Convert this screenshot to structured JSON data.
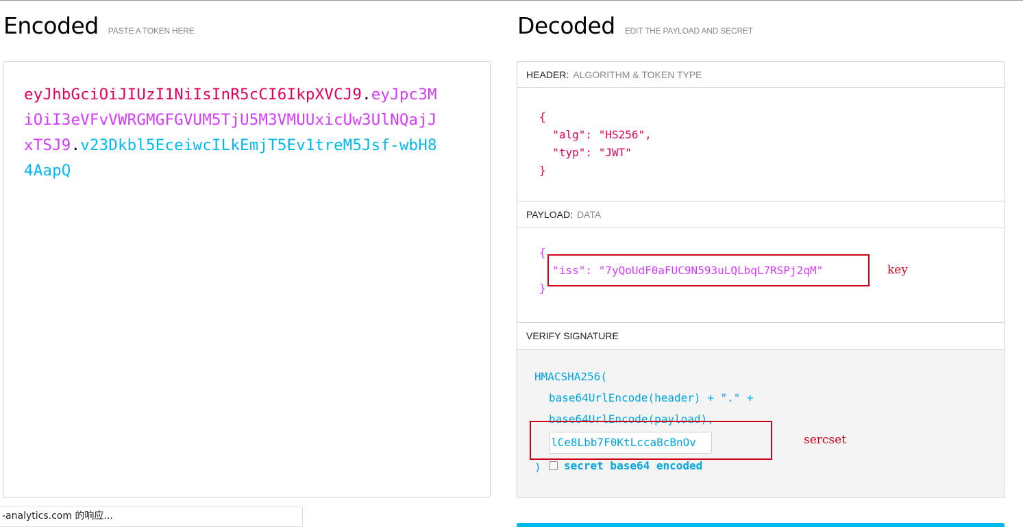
{
  "encoded": {
    "title": "Encoded",
    "subtitle": "PASTE A TOKEN HERE",
    "token_header": "eyJhbGciOiJIUzI1NiIsInR5cCI6IkpXVCJ9",
    "token_payload": "eyJpc3MiOiI3eVFvVWRGMGFGVUM5TjU5M3VMUUxicUw3UlNQajJxTSJ9",
    "token_signature": "v23Dkbl5EceiwcILkEmjT5Ev1treM5Jsf-wbH84AapQ",
    "dot": "."
  },
  "decoded": {
    "title": "Decoded",
    "subtitle": "EDIT THE PAYLOAD AND SECRET",
    "header_section": {
      "label": "HEADER:",
      "sublabel": "ALGORITHM & TOKEN TYPE",
      "json": "{\n  \"alg\": \"HS256\",\n  \"typ\": \"JWT\"\n}"
    },
    "payload_section": {
      "label": "PAYLOAD:",
      "sublabel": "DATA",
      "json": "{\n  \"iss\": \"7yQoUdF0aFUC9N593uLQLbqL7RSPj2qM\"\n}"
    },
    "verify_section": {
      "label": "VERIFY SIGNATURE",
      "line1": "HMACSHA256(",
      "line2": "base64UrlEncode(header) + \".\" +",
      "line3": "base64UrlEncode(payload),",
      "secret_value": "lCe8Lbb7F0KtLccaBcBnOv",
      "close": ")",
      "base64_label": "secret base64 encoded",
      "base64_checked": false
    }
  },
  "annotations": {
    "key_note": "key",
    "secret_note": "sercset"
  },
  "status_bar": {
    "text": "-analytics.com 的响应..."
  },
  "colors": {
    "header": "#e3005a",
    "payload": "#d63aff",
    "signature": "#00b9f1",
    "annotation": "#d0021b"
  }
}
